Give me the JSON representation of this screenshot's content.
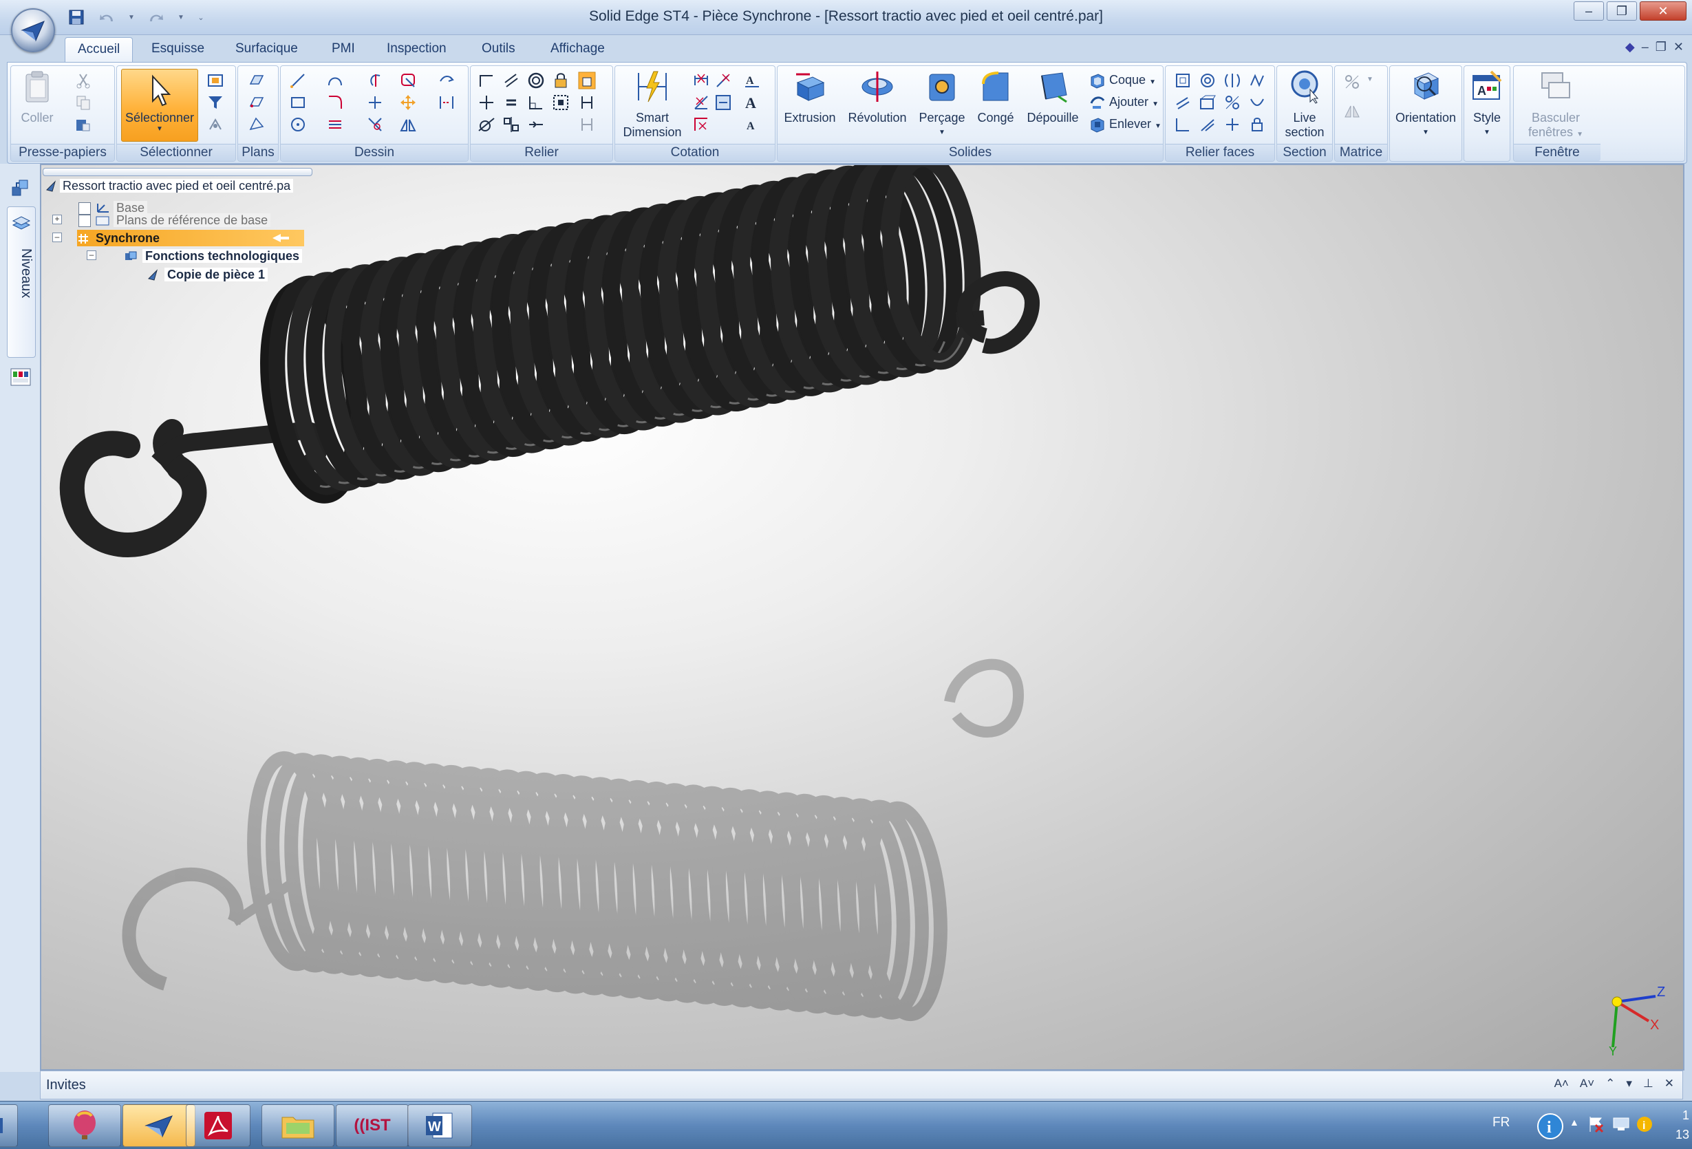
{
  "window": {
    "title": "Solid Edge ST4 - Pièce Synchrone - [Ressort tractio avec pied et oeil centré.par]"
  },
  "tabs": [
    "Accueil",
    "Esquisse",
    "Surfacique",
    "PMI",
    "Inspection",
    "Outils",
    "Affichage"
  ],
  "active_tab": "Accueil",
  "ribbon": {
    "presse_papiers": {
      "label": "Presse-papiers",
      "coller": "Coller"
    },
    "selectionner": {
      "label": "Sélectionner",
      "button": "Sélectionner"
    },
    "plans": {
      "label": "Plans"
    },
    "dessin": {
      "label": "Dessin"
    },
    "relier": {
      "label": "Relier"
    },
    "cotation": {
      "label": "Cotation",
      "smart_line1": "Smart",
      "smart_line2": "Dimension"
    },
    "solides": {
      "label": "Solides",
      "extrusion": "Extrusion",
      "revolution": "Révolution",
      "percage": "Perçage",
      "conge": "Congé",
      "depouille": "Dépouille",
      "coque": "Coque",
      "ajouter": "Ajouter",
      "enlever": "Enlever"
    },
    "relier_faces": {
      "label": "Relier faces"
    },
    "section": {
      "label": "Section",
      "live_line1": "Live",
      "live_line2": "section"
    },
    "matrice": {
      "label": "Matrice"
    },
    "orientation": {
      "button": "Orientation"
    },
    "style": {
      "button": "Style"
    },
    "fenetre": {
      "label": "Fenêtre",
      "basculer_line1": "Basculer",
      "basculer_line2": "fenêtres"
    }
  },
  "sidebar": {
    "niveaux": "Niveaux"
  },
  "tree": {
    "root": "Ressort tractio avec pied et oeil centré.pa",
    "base": "Base",
    "plans_ref": "Plans de référence de base",
    "synchrone": "Synchrone",
    "fonctions": "Fonctions technologiques",
    "copie": "Copie de pièce 1"
  },
  "triad": {
    "x": "X",
    "y": "Y",
    "z": "Z"
  },
  "invites": {
    "label": "Invites"
  },
  "taskbar": {
    "lang": "FR",
    "clock_line1": "1",
    "clock_line2": "13",
    "ist_label": "IST"
  },
  "colors": {
    "ribbon_highlight": "#f7a020",
    "synchrone_highlight": "#f6a623",
    "spring": "#1e1e1e"
  }
}
